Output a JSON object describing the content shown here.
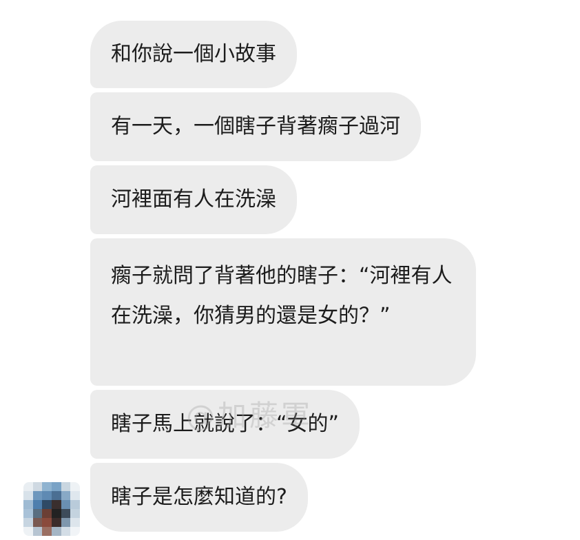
{
  "messages": [
    {
      "text": "和你說一個小故事"
    },
    {
      "text": "有一天，一個瞎子背著瘸子過河"
    },
    {
      "text": "河裡面有人在洗澡"
    },
    {
      "text": "瘸子就問了背著他的瞎子：“河裡有人在洗澡，你猜男的還是女的？”"
    },
    {
      "text": "瞎子馬上就說了：“女的”"
    },
    {
      "text": "瞎子是怎麼知道的?"
    }
  ],
  "watermark": "@加藤軍",
  "colors": {
    "bubble": "#ececec",
    "text": "#1c1c1c",
    "background": "#ffffff"
  },
  "avatar": {
    "icon": "pixelated-avatar-icon"
  }
}
